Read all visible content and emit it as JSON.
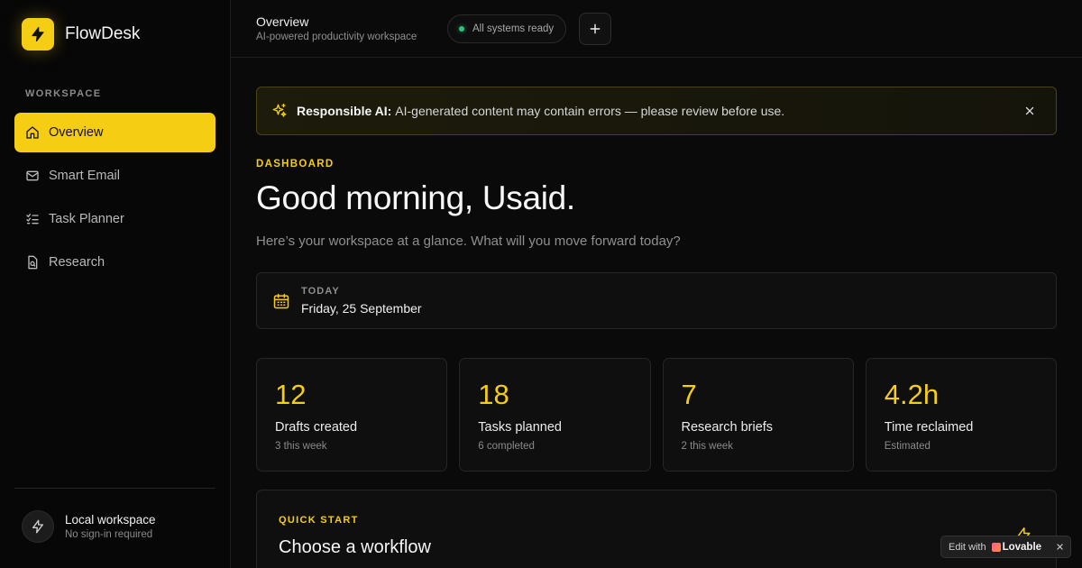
{
  "app": {
    "name": "FlowDesk",
    "accent": "#f5cd12"
  },
  "sidebar": {
    "section_label": "WORKSPACE",
    "items": [
      {
        "label": "Overview",
        "icon": "home-icon",
        "active": true
      },
      {
        "label": "Smart Email",
        "icon": "mail-icon",
        "active": false
      },
      {
        "label": "Task Planner",
        "icon": "checklist-icon",
        "active": false
      },
      {
        "label": "Research",
        "icon": "document-search-icon",
        "active": false
      }
    ],
    "account": {
      "name": "Local workspace",
      "subtitle": "No sign-in required",
      "icon": "bolt-icon"
    }
  },
  "header": {
    "title": "Overview",
    "subtitle": "AI-powered productivity workspace",
    "status": "All systems ready",
    "status_color": "#2ec27e"
  },
  "banner": {
    "title": "Responsible AI:",
    "message": "AI-generated content may contain errors — please review before use.",
    "icon": "sparkles-icon"
  },
  "dashboard": {
    "eyebrow": "DASHBOARD",
    "greeting": "Good morning, Usaid.",
    "intro": "Here’s your workspace at a glance. What will you move forward today?"
  },
  "today": {
    "label": "TODAY",
    "date": "Friday, 25 September",
    "icon": "calendar-icon"
  },
  "stats": [
    {
      "value": "12",
      "label": "Drafts created",
      "sub": "3 this week"
    },
    {
      "value": "18",
      "label": "Tasks planned",
      "sub": "6 completed"
    },
    {
      "value": "7",
      "label": "Research briefs",
      "sub": "2 this week"
    },
    {
      "value": "4.2h",
      "label": "Time reclaimed",
      "sub": "Estimated"
    }
  ],
  "quick_start": {
    "eyebrow": "QUICK START",
    "title": "Choose a workflow",
    "icon": "bolt-icon"
  },
  "lovable_badge": {
    "prefix": "Edit with",
    "brand": "Lovable"
  }
}
